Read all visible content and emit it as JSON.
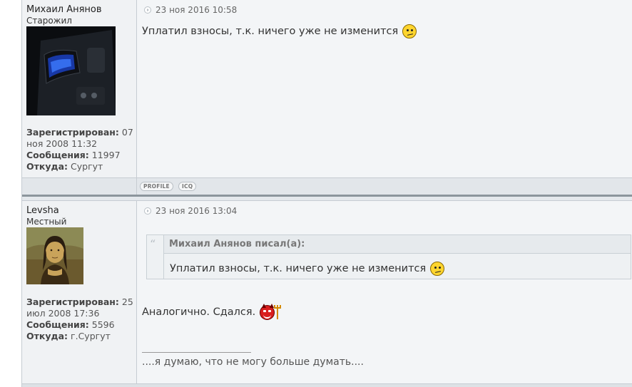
{
  "posts": [
    {
      "author": "Михаил Анянов",
      "rank": "Старожил",
      "registered_label": "Зарегистрирован:",
      "registered": "07 ноя 2008 11:32",
      "messages_label": "Сообщения:",
      "messages": "11997",
      "from_label": "Откуда:",
      "from": "Сургут",
      "date": "23 ноя 2016 10:58",
      "text": "Уплатил взносы, т.к. ничего уже не изменится",
      "buttons": [
        "PROFILE",
        "ICQ"
      ]
    },
    {
      "author": "Levsha",
      "rank": "Местный",
      "registered_label": "Зарегистрирован:",
      "registered": "25 июл 2008 17:36",
      "messages_label": "Сообщения:",
      "messages": "5596",
      "from_label": "Откуда:",
      "from": "г.Сургут",
      "date": "23 ноя 2016 13:04",
      "quote_author": "Михаил Анянов писал(а):",
      "quote_text": "Уплатил взносы, т.к. ничего уже не изменится",
      "text": "Аналогично. Сдался.",
      "signature": "....я думаю, что не могу больше думать...."
    }
  ],
  "colors": {
    "background": "#f3f5f7",
    "border": "#c6ccd2",
    "footer": "#e2e6ea"
  },
  "icons": [
    "post-date-icon",
    "confused-smiley-icon",
    "devil-smiley-icon",
    "quote-icon"
  ]
}
